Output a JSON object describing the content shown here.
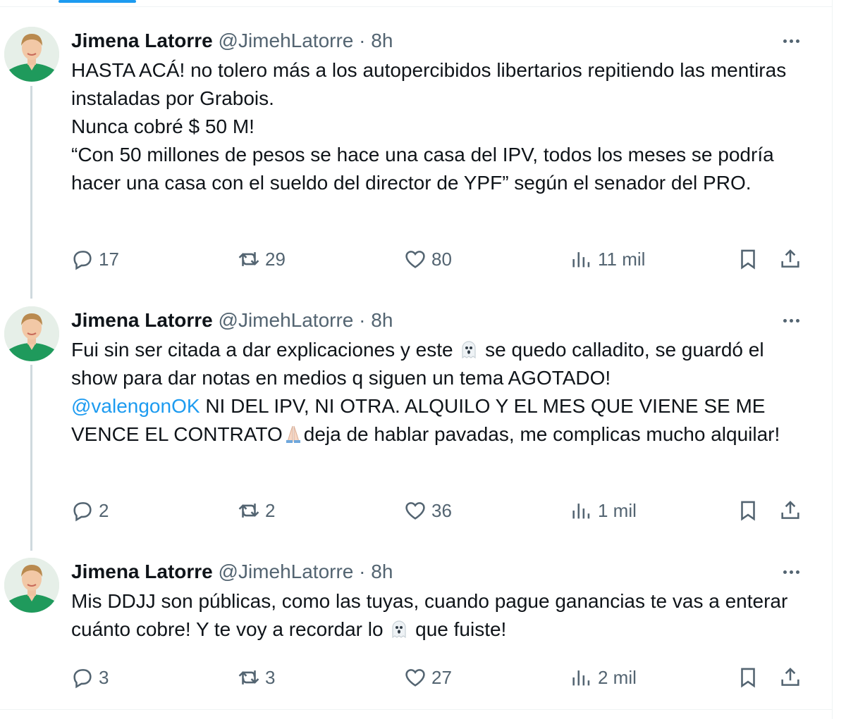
{
  "tweets": [
    {
      "author": "Jimena Latorre",
      "handle": "@JimehLatorre",
      "separator": "·",
      "time": "8h",
      "lines": [
        "HASTA ACÁ! no tolero más a los autopercibidos libertarios repitiendo las mentiras instaladas por Grabois.",
        "Nunca cobré $ 50 M!",
        "“Con 50 millones de pesos se hace una casa del IPV, todos los meses se podría hacer una casa con el sueldo del director de YPF” según el senador del PRO."
      ],
      "replies": "17",
      "reposts": "29",
      "likes": "80",
      "views": "11 mil"
    },
    {
      "author": "Jimena Latorre",
      "handle": "@JimehLatorre",
      "separator": "·",
      "time": "8h",
      "line1_a": "Fui sin ser citada a dar explicaciones y este",
      "line1_b": "se quedo calladito, se guardó el show para dar notas en medios q siguen un tema AGOTADO!",
      "mention": "@valengonOK",
      "line2_a": "NI DEL IPV, NI OTRA. ALQUILO Y EL MES QUE VIENE SE ME VENCE EL CONTRATO",
      "line2_b": "deja de hablar pavadas, me complicas mucho alquilar!",
      "replies": "2",
      "reposts": "2",
      "likes": "36",
      "views": "1 mil"
    },
    {
      "author": "Jimena Latorre",
      "handle": "@JimehLatorre",
      "separator": "·",
      "time": "8h",
      "line1_a": "Mis DDJJ son públicas, como las tuyas, cuando pague ganancias te vas a enterar cuánto cobre! Y te voy a recordar lo",
      "line1_b": "que fuiste!",
      "replies": "3",
      "reposts": "3",
      "likes": "27",
      "views": "2 mil"
    }
  ],
  "icons": {
    "reply": "reply-icon",
    "repost": "repost-icon",
    "like": "heart-icon",
    "views": "views-chart-icon",
    "bookmark": "bookmark-icon",
    "share": "share-icon",
    "more": "more-options-icon",
    "ghost": "ghost-emoji",
    "pray": "folded-hands-emoji"
  },
  "colors": {
    "accent": "#1d9bf0",
    "secondary_text": "#536471",
    "thread_line": "#cfd9de"
  }
}
